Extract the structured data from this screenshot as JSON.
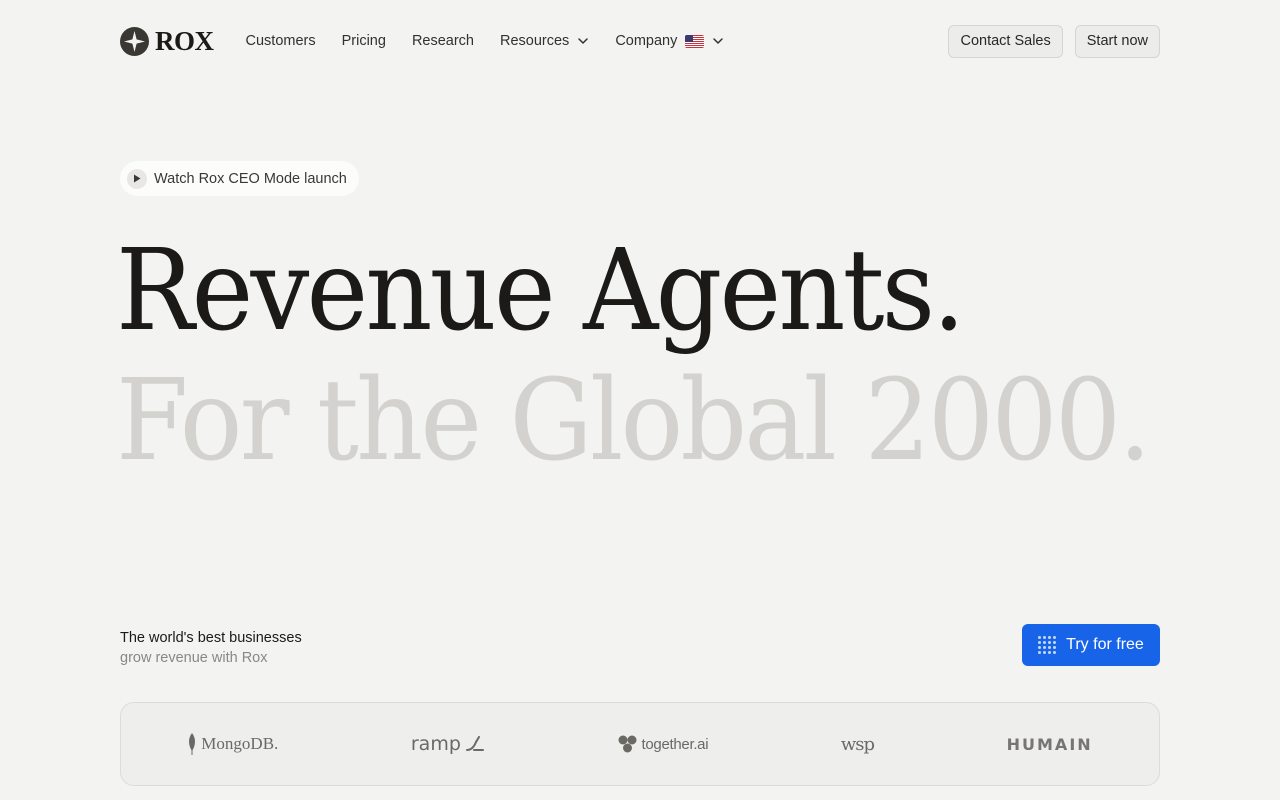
{
  "nav": {
    "logo_text": "ROX",
    "links": [
      {
        "label": "Customers"
      },
      {
        "label": "Pricing"
      },
      {
        "label": "Research"
      },
      {
        "label": "Resources"
      },
      {
        "label": "Company"
      }
    ],
    "contact_sales": "Contact Sales",
    "start_now": "Start now"
  },
  "hero": {
    "video_pill": "Watch Rox CEO Mode launch",
    "headline_1": "Revenue Agents.",
    "headline_2": "For the Global 2000."
  },
  "tagline": {
    "line1": "The world's best businesses",
    "line2": "grow revenue with Rox"
  },
  "cta": {
    "try_free": "Try for free"
  },
  "customers": [
    {
      "name": "MongoDB.",
      "icon": "leaf-icon"
    },
    {
      "name": "ramp",
      "icon": "ramp-icon"
    },
    {
      "name": "together.ai",
      "icon": "together-icon"
    },
    {
      "name": "wsp",
      "icon": ""
    },
    {
      "name": "HUMAIN",
      "icon": ""
    }
  ],
  "colors": {
    "background": "#f3f3f2",
    "primary": "#1764e8",
    "headline": "#1c1a17",
    "headline_muted": "#d3d2ce"
  }
}
